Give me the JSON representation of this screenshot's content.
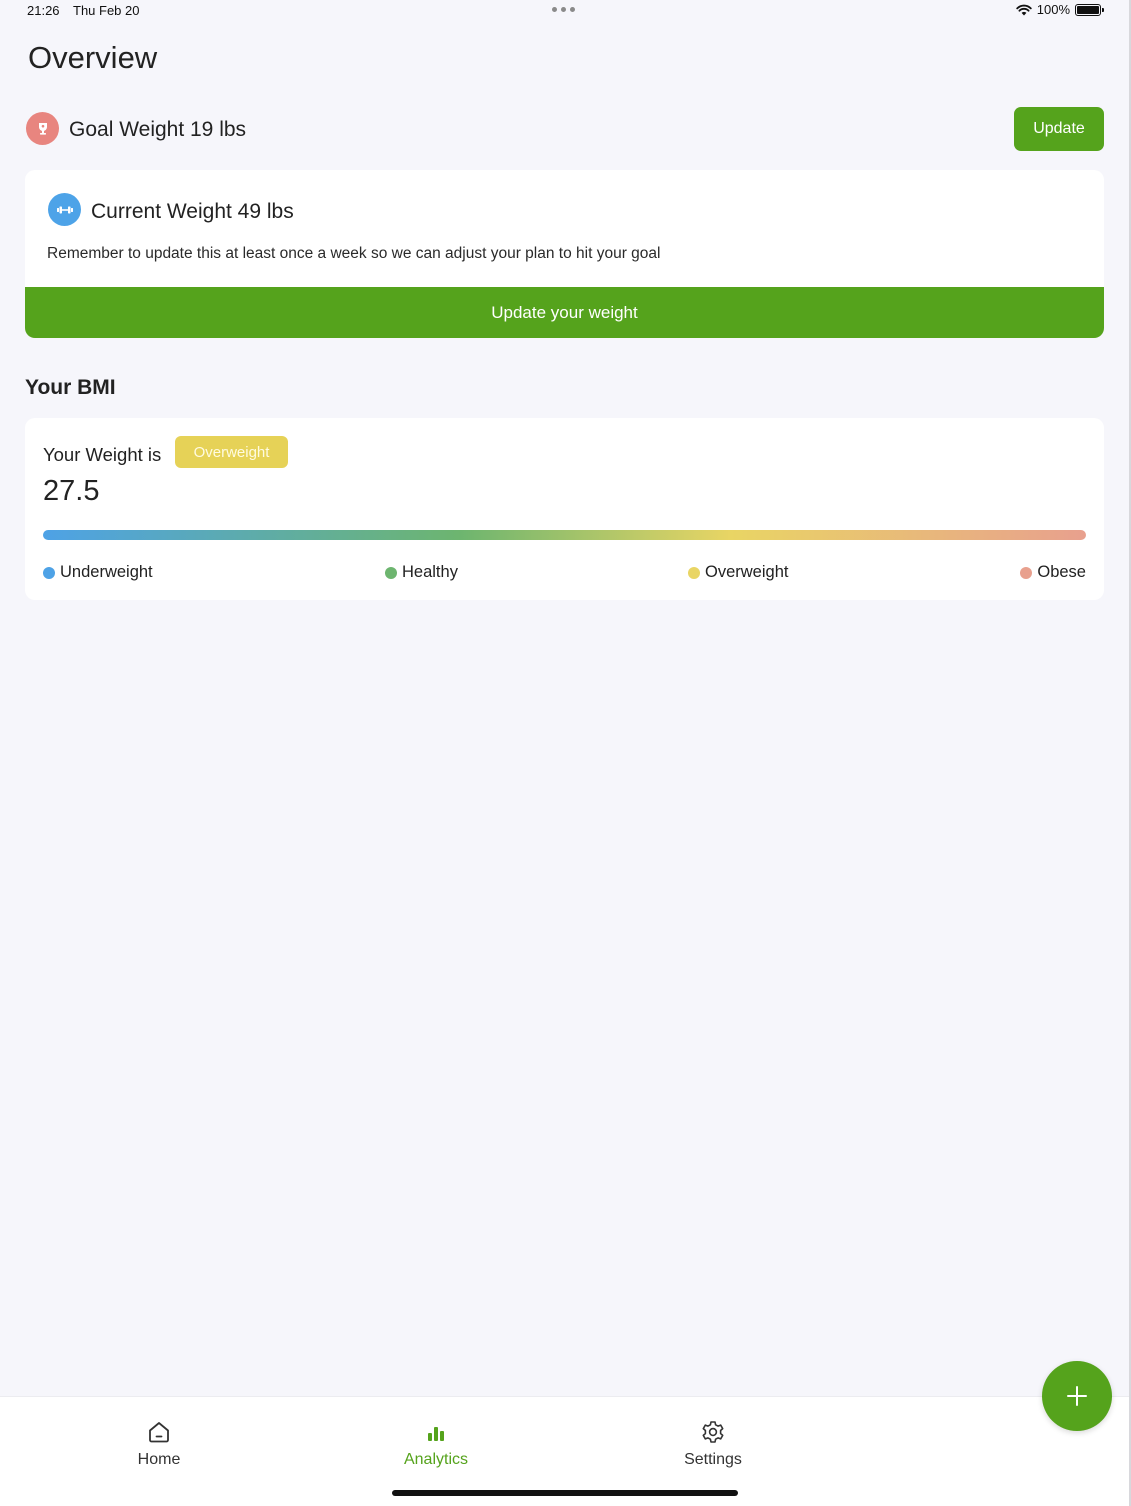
{
  "status_bar": {
    "time": "21:26",
    "date": "Thu Feb 20",
    "battery": "100%"
  },
  "page": {
    "title": "Overview"
  },
  "goal": {
    "text": "Goal Weight 19 lbs",
    "update_label": "Update",
    "icon": "trophy-icon"
  },
  "current_weight": {
    "title": "Current Weight 49 lbs",
    "note": "Remember to update this at least once a week so we can adjust your plan to hit your goal",
    "button_label": "Update your weight",
    "icon": "dumbbell-icon"
  },
  "bmi": {
    "heading": "Your BMI",
    "label": "Your Weight is",
    "badge": "Overweight",
    "value": "27.5",
    "legend": [
      {
        "label": "Underweight",
        "color": "#4ea2e6"
      },
      {
        "label": "Healthy",
        "color": "#6db56f"
      },
      {
        "label": "Overweight",
        "color": "#e9d564"
      },
      {
        "label": "Obese",
        "color": "#e8a08e"
      }
    ]
  },
  "tabs": [
    {
      "label": "Home",
      "icon": "home-icon",
      "active": false
    },
    {
      "label": "Analytics",
      "icon": "bar-chart-icon",
      "active": true
    },
    {
      "label": "Settings",
      "icon": "gear-icon",
      "active": false
    }
  ],
  "colors": {
    "accent": "#55a31c",
    "badge": "#e6d257",
    "goal_icon_bg": "#e8857f",
    "current_icon_bg": "#4da3e8"
  }
}
